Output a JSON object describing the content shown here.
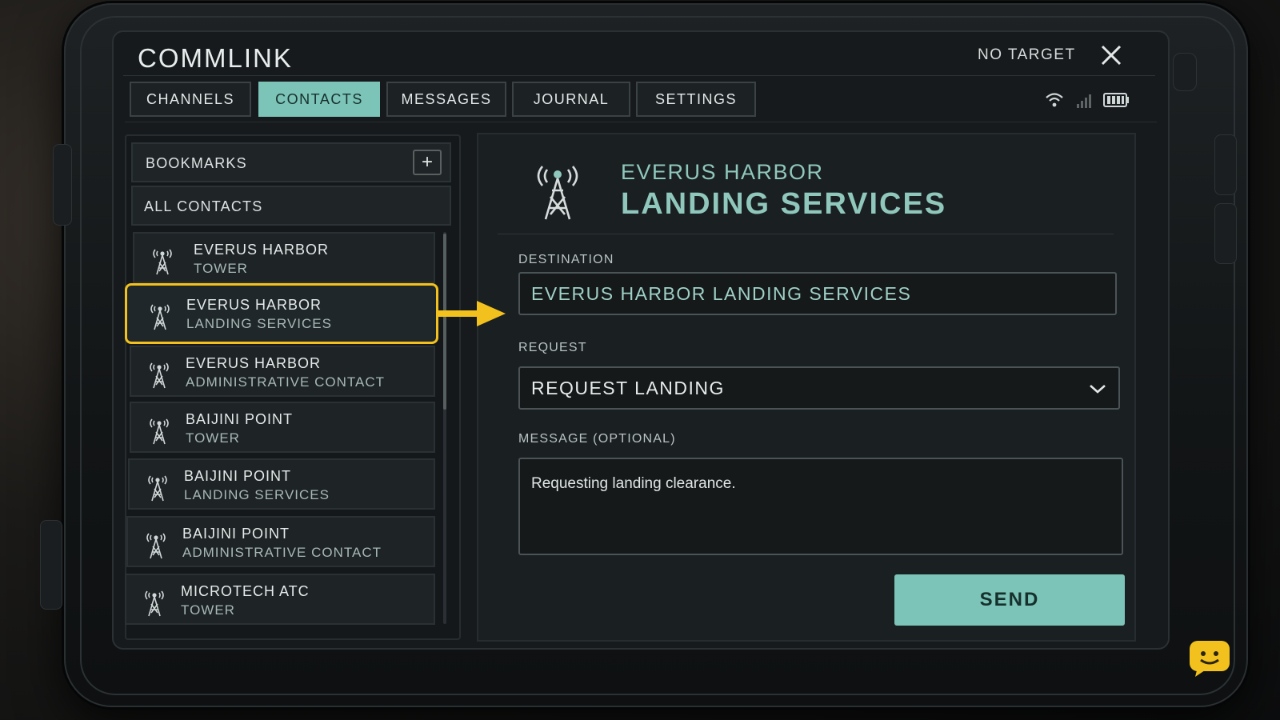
{
  "header": {
    "title": "COMMLINK",
    "target_status": "NO TARGET"
  },
  "tabs": [
    {
      "label": "CHANNELS",
      "active": false
    },
    {
      "label": "CONTACTS",
      "active": true
    },
    {
      "label": "MESSAGES",
      "active": false
    },
    {
      "label": "JOURNAL",
      "active": false
    },
    {
      "label": "SETTINGS",
      "active": false
    }
  ],
  "sidebar": {
    "bookmarks_label": "BOOKMARKS",
    "add_label": "+",
    "all_contacts_label": "ALL CONTACTS",
    "contacts": [
      {
        "name": "EVERUS HARBOR",
        "sub": "TOWER",
        "selected": false
      },
      {
        "name": "EVERUS HARBOR",
        "sub": "LANDING SERVICES",
        "selected": true
      },
      {
        "name": "EVERUS HARBOR",
        "sub": "ADMINISTRATIVE CONTACT",
        "selected": false
      },
      {
        "name": "BAIJINI POINT",
        "sub": "TOWER",
        "selected": false
      },
      {
        "name": "BAIJINI POINT",
        "sub": "LANDING SERVICES",
        "selected": false
      },
      {
        "name": "BAIJINI POINT",
        "sub": "ADMINISTRATIVE CONTACT",
        "selected": false
      },
      {
        "name": "MICROTECH ATC",
        "sub": "TOWER",
        "selected": false
      }
    ]
  },
  "detail": {
    "title_line1": "EVERUS HARBOR",
    "title_line2": "LANDING SERVICES",
    "destination_label": "DESTINATION",
    "destination_value": "EVERUS HARBOR LANDING SERVICES",
    "request_label": "REQUEST",
    "request_value": "REQUEST LANDING",
    "message_label": "MESSAGE (OPTIONAL)",
    "message_value": "Requesting landing clearance.",
    "send_label": "SEND"
  },
  "colors": {
    "accent": "#7cc3b8",
    "highlight": "#f2c11d",
    "background": "#161a1c"
  }
}
